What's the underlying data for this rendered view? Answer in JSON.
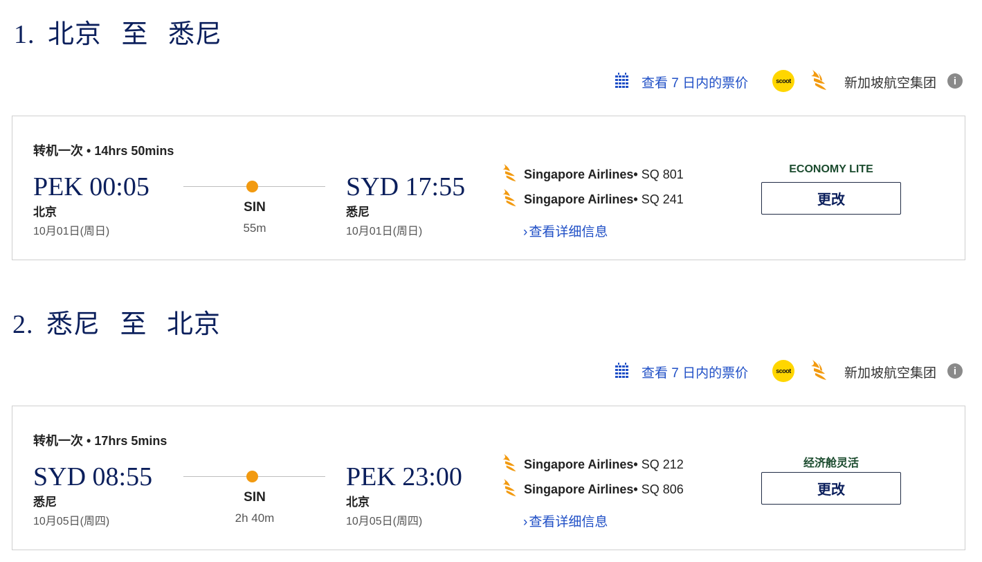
{
  "segments": [
    {
      "number": "1.",
      "from_city": "北京",
      "to_word": "至",
      "to_city": "悉尼",
      "toolbar": {
        "price_link": "查看 7 日内的票价",
        "scoot_text": "scoot",
        "group_name": "新加坡航空集团",
        "info_symbol": "i"
      },
      "card": {
        "stops_label": "转机一次",
        "duration": "14hrs 50mins",
        "departure": {
          "code_time": "PEK 00:05",
          "city": "北京",
          "date": "10月01日(周日)"
        },
        "stop": {
          "code": "SIN",
          "layover": "55m"
        },
        "arrival": {
          "code_time": "SYD 17:55",
          "city": "悉尼",
          "date": "10月01日(周日)"
        },
        "flights": [
          {
            "airline": "Singapore Airlines",
            "number": "SQ 801"
          },
          {
            "airline": "Singapore Airlines",
            "number": "SQ 241"
          }
        ],
        "details_link": "查看详细信息",
        "fare_class": "ECONOMY LITE",
        "change_label": "更改"
      }
    },
    {
      "number": "2.",
      "from_city": "悉尼",
      "to_word": "至",
      "to_city": "北京",
      "toolbar": {
        "price_link": "查看 7 日内的票价",
        "scoot_text": "scoot",
        "group_name": "新加坡航空集团",
        "info_symbol": "i"
      },
      "card": {
        "stops_label": "转机一次",
        "duration": "17hrs 5mins",
        "departure": {
          "code_time": "SYD 08:55",
          "city": "悉尼",
          "date": "10月05日(周四)"
        },
        "stop": {
          "code": "SIN",
          "layover": "2h 40m"
        },
        "arrival": {
          "code_time": "PEK 23:00",
          "city": "北京",
          "date": "10月05日(周四)"
        },
        "flights": [
          {
            "airline": "Singapore Airlines",
            "number": "SQ 212"
          },
          {
            "airline": "Singapore Airlines",
            "number": "SQ 806"
          }
        ],
        "details_link": "查看详细信息",
        "fare_class": "经济舱灵活",
        "change_label": "更改"
      }
    }
  ],
  "colors": {
    "title_navy": "#0b1f5c",
    "link_blue": "#1f4fc6",
    "stop_orange": "#f29a10",
    "scoot_yellow": "#ffd600",
    "fare_green": "#1b4b2e"
  },
  "icons": {
    "calendar": "calendar-grid-icon",
    "scoot": "scoot-logo",
    "airline": "singapore-airlines-bird-icon",
    "info": "info-circle-icon",
    "chevron": "chevron-right-icon"
  }
}
